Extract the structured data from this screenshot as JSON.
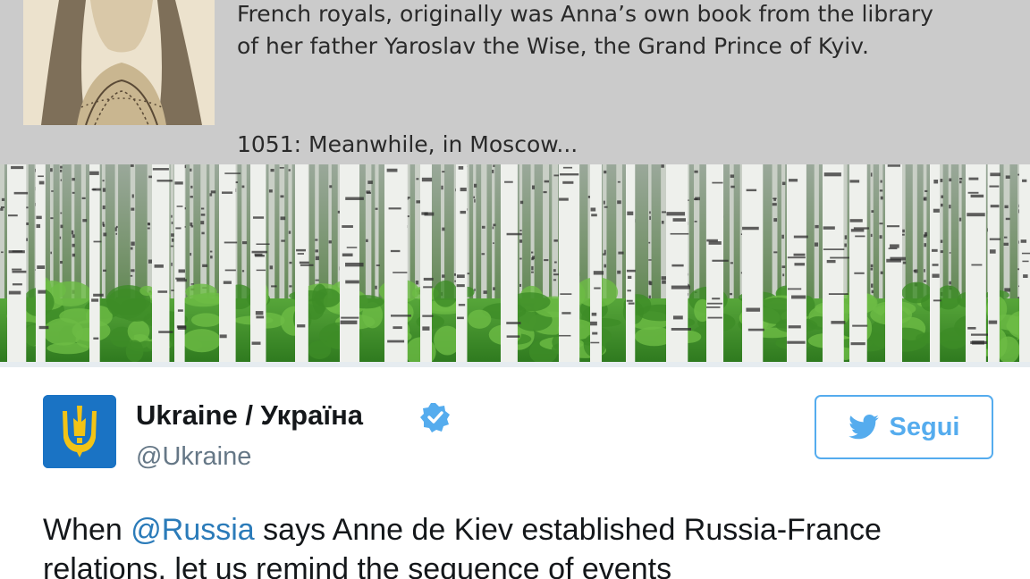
{
  "meme": {
    "line1": "French royals, originally was Anna’s own book from the library",
    "line2": "of her father Yaroslav the Wise, the Grand Prince of Kyiv.",
    "caption": "1051: Meanwhile, in Moscow..."
  },
  "tweet": {
    "display_name": "Ukraine / Україна",
    "handle": "@Ukraine",
    "follow_label": "Segui",
    "text_mention": "@Russia",
    "text_line1_prefix": "When ",
    "text_line1_suffix": " says Anne de Kiev established Russia-France",
    "text_line2": "relations, let us remind the sequence of events"
  },
  "icons": {
    "avatar": "trident-icon",
    "verified": "verified-badge-icon",
    "follow": "twitter-bird-icon"
  },
  "colors": {
    "accent": "#55acee",
    "mention": "#2b7bb9",
    "avatar_bg": "#1a73c4",
    "trident": "#f2c316",
    "meme_bg": "#cbcbcb"
  }
}
